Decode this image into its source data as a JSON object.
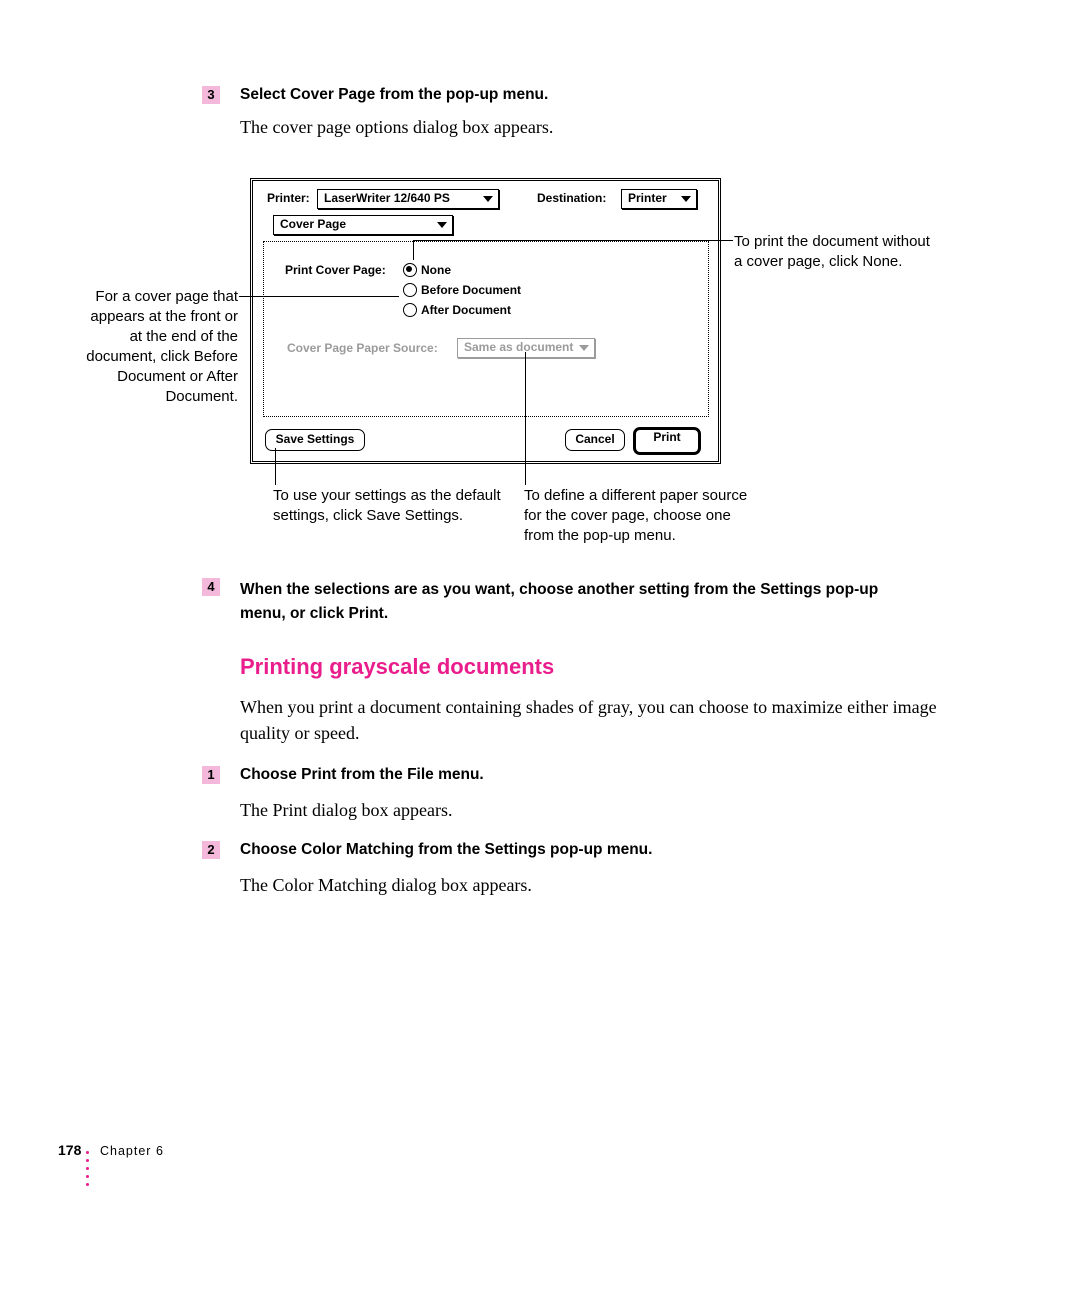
{
  "step3": {
    "num": "3",
    "heading": "Select Cover Page from the pop-up menu.",
    "body": "The cover page options dialog box appears."
  },
  "callouts": {
    "left": "For a cover page that appears at the front or at the end of the document, click Before Document or After Document.",
    "right": "To print the document without a cover page, click None.",
    "bottom_left": "To use your settings as the default settings, click Save Settings.",
    "bottom_right": "To define a different paper source for the cover page, choose one from the pop-up menu."
  },
  "dialog": {
    "printer_label": "Printer:",
    "printer_value": "LaserWriter 12/640 PS",
    "dest_label": "Destination:",
    "dest_value": "Printer",
    "menu": "Cover Page",
    "opt_label": "Print Cover Page:",
    "opt_none": "None",
    "opt_before": "Before Document",
    "opt_after": "After Document",
    "src_label": "Cover Page Paper Source:",
    "src_value": "Same as document",
    "save": "Save Settings",
    "cancel": "Cancel",
    "print": "Print"
  },
  "step4": {
    "num": "4",
    "heading": "When the selections are as you want, choose another setting from the Settings pop-up menu, or click Print."
  },
  "section_title": "Printing grayscale documents",
  "section_body": "When you print a document containing shades of gray, you can choose to maximize either image quality or speed.",
  "stepA": {
    "num": "1",
    "heading": "Choose Print from the File menu.",
    "body": "The Print dialog box appears."
  },
  "stepB": {
    "num": "2",
    "heading": "Choose Color Matching from the Settings pop-up menu.",
    "body": "The Color Matching dialog box appears."
  },
  "footer": {
    "page": "178",
    "chapter": "Chapter 6"
  }
}
